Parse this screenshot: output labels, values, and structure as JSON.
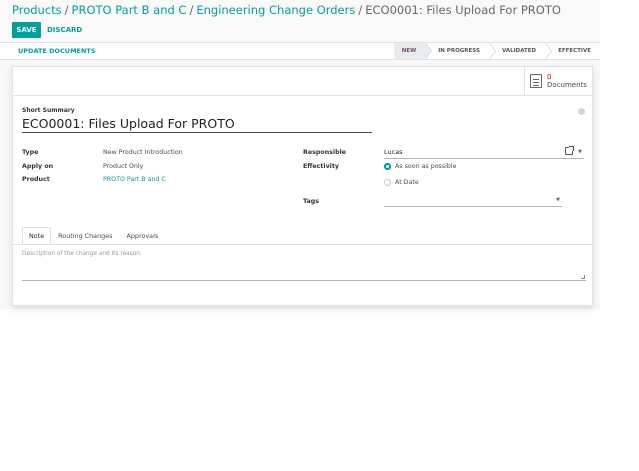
{
  "breadcrumb": {
    "items": [
      "Products",
      "PROTO Part B and C",
      "Engineering Change Orders"
    ],
    "current": "ECO0001: Files Upload For PROTO",
    "separator": "/"
  },
  "toolbar": {
    "save_label": "SAVE",
    "discard_label": "DISCARD"
  },
  "statusbar": {
    "action_label": "UPDATE DOCUMENTS",
    "stages": [
      "NEW",
      "IN PROGRESS",
      "VALIDATED",
      "EFFECTIVE"
    ],
    "active_stage": "NEW"
  },
  "button_box": {
    "documents_count": "0",
    "documents_label": "Documents"
  },
  "form": {
    "short_summary_label": "Short Summary",
    "title": "ECO0001: Files Upload For PROTO",
    "type_label": "Type",
    "type_value": "New Product Introduction",
    "apply_on_label": "Apply on",
    "apply_on_value": "Product Only",
    "product_label": "Product",
    "product_value": "PROTO Part B and C",
    "responsible_label": "Responsible",
    "responsible_value": "Lucas",
    "effectivity_label": "Effectivity",
    "effectivity_options": [
      "As soon as possible",
      "At Date"
    ],
    "effectivity_selected": "As soon as possible",
    "tags_label": "Tags"
  },
  "notebook": {
    "tabs": [
      "Note",
      "Routing Changes",
      "Approvals"
    ],
    "active_tab": "Note",
    "note_placeholder": "Description of the change and its reason."
  },
  "colors": {
    "accent": "#00a09d",
    "active_stage_text": "#714b67",
    "documents_count": "#cc0000"
  },
  "icons": [
    "document-icon",
    "external-link-icon",
    "dropdown-caret-icon",
    "resize-handle-icon"
  ]
}
